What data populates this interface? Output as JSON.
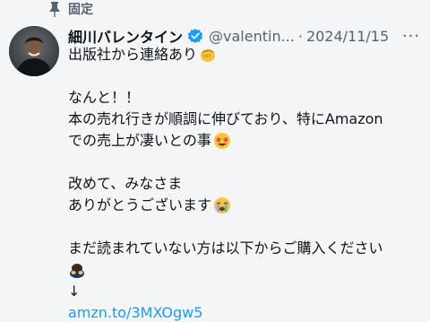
{
  "pinned": {
    "label": "固定",
    "icon": "pin-icon"
  },
  "author": {
    "name": "細川バレンタイン",
    "handle": "@valentin...",
    "separator": "·",
    "date": "2024/11/15",
    "verified_color": "#1d9bf0",
    "avatar_icon": "avatar-photo"
  },
  "more_label": "···",
  "post": {
    "line1": "出版社から連絡あり",
    "line2": "なんと！！",
    "line3": "本の売れ行きが順調に伸びており、特にAmazon",
    "line4": "での売上が凄いとの事",
    "line5": "改めて、みなさま",
    "line6": "ありがとうございます",
    "line7": "まだ読まれていない方は以下からご購入ください",
    "arrow": "↓",
    "link": "amzn.to/3MXOgw5"
  },
  "emojis": {
    "line1": "fist-emoji",
    "line4": "star-struck-emoji",
    "line6": "crying-emoji",
    "line7": "bowing-emoji"
  },
  "colors": {
    "link": "#1d9bf0",
    "secondary_text": "#536471",
    "background": "#f3f5f6"
  }
}
